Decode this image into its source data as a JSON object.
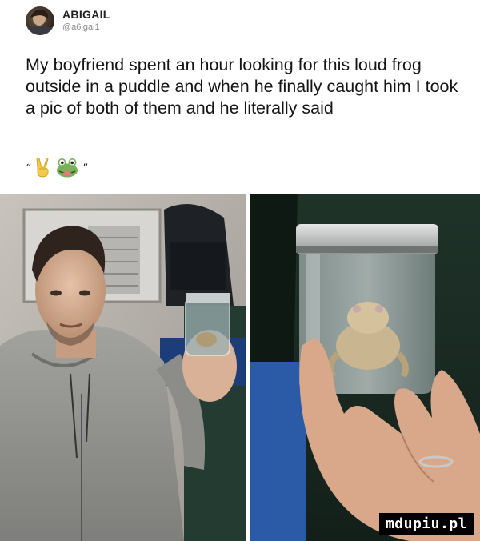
{
  "post": {
    "display_name": "ABIGAIL",
    "handle": "@a6igai1",
    "text": "My boyfriend spent an hour looking for this loud frog outside in a puddle and when he finally caught him I took a pic of both of them and he literally said",
    "quote_open": "“",
    "quote_close": "”"
  },
  "icons": {
    "avatar": "profile-photo",
    "emoji_1": "victory-hand-emoji",
    "emoji_2": "frog-emoji"
  },
  "watermark": {
    "text": "mdupiu.pl"
  }
}
